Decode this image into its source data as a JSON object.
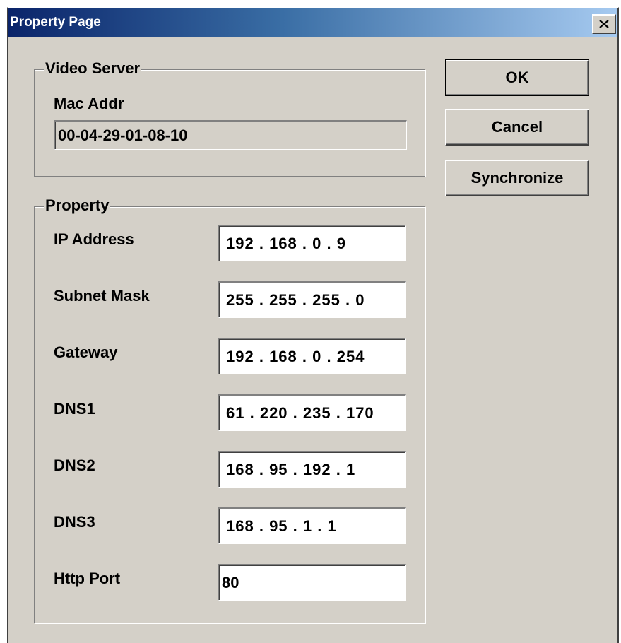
{
  "window": {
    "title": "Property Page",
    "close_glyph": "×"
  },
  "video_server": {
    "legend": "Video Server",
    "mac_label": "Mac Addr",
    "mac_value": "00-04-29-01-08-10"
  },
  "property": {
    "legend": "Property",
    "fields": [
      {
        "label": "IP Address",
        "octets": [
          "192",
          "168",
          "0",
          "9"
        ]
      },
      {
        "label": "Subnet Mask",
        "octets": [
          "255",
          "255",
          "255",
          "0"
        ]
      },
      {
        "label": "Gateway",
        "octets": [
          "192",
          "168",
          "0",
          "254"
        ]
      },
      {
        "label": "DNS1",
        "octets": [
          "61",
          "220",
          "235",
          "170"
        ]
      },
      {
        "label": "DNS2",
        "octets": [
          "168",
          "95",
          "192",
          "1"
        ]
      },
      {
        "label": "DNS3",
        "octets": [
          "168",
          "95",
          "1",
          "1"
        ]
      }
    ],
    "http_port_label": "Http Port",
    "http_port_value": "80"
  },
  "buttons": {
    "ok": "OK",
    "cancel": "Cancel",
    "synchronize": "Synchronize"
  },
  "colors": {
    "face": "#d4d0c8",
    "title_start": "#0a246a",
    "title_end": "#a6caf0"
  }
}
